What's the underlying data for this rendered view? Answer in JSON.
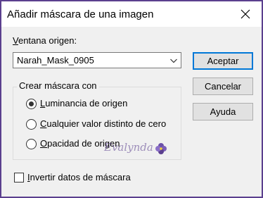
{
  "window": {
    "title": "Añadir máscara de una imagen",
    "close_icon": "close-icon"
  },
  "source": {
    "label_prefix": "V",
    "label_rest": "entana origen:",
    "selected_value": "Narah_Mask_0905",
    "dropdown_icon": "chevron-down-icon"
  },
  "buttons": {
    "ok": "Aceptar",
    "cancel": "Cancelar",
    "help": "Ayuda"
  },
  "mask_group": {
    "legend": "Crear máscara con",
    "options": [
      {
        "mnemonic": "L",
        "rest": "uminancia de origen",
        "selected": true
      },
      {
        "mnemonic": "C",
        "rest": "ualquier valor distinto de cero",
        "selected": false
      },
      {
        "mnemonic": "O",
        "rest": "pacidad de origen",
        "selected": false
      }
    ]
  },
  "invert": {
    "mnemonic": "I",
    "rest": "nvertir datos de máscara",
    "checked": false
  },
  "watermark": {
    "text": "Evalynda"
  },
  "colors": {
    "window_border": "#5b3f8e",
    "default_button_border": "#0078d7",
    "face": "#f0f0f0"
  }
}
